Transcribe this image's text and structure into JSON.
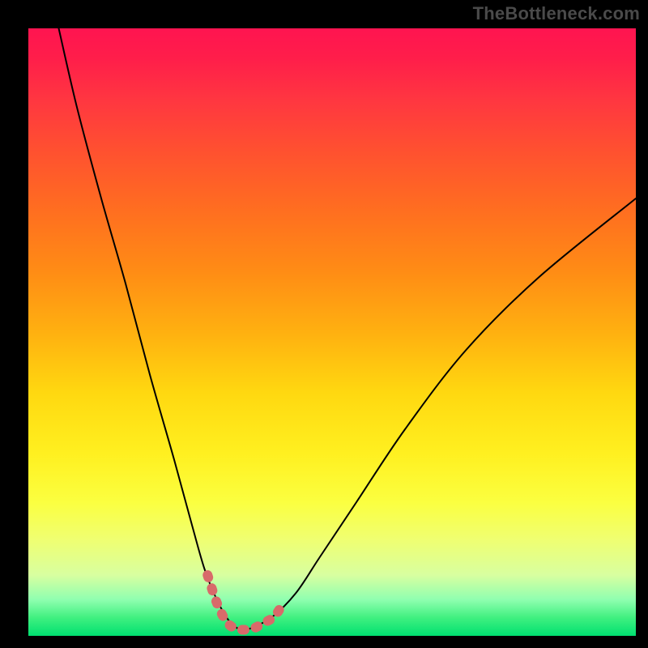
{
  "watermark": "TheBottleneck.com",
  "chart_data": {
    "type": "line",
    "title": "",
    "xlabel": "",
    "ylabel": "",
    "xlim": [
      0,
      100
    ],
    "ylim": [
      0,
      100
    ],
    "grid": false,
    "series": [
      {
        "name": "main-curve",
        "color": "#000000",
        "stroke_width": 2,
        "x": [
          5,
          8,
          12,
          16,
          20,
          24,
          27,
          29,
          31,
          33,
          34.5,
          35.5,
          36.5,
          40,
          44,
          48,
          54,
          62,
          72,
          84,
          100
        ],
        "y": [
          100,
          87,
          72,
          58,
          43,
          29,
          18,
          11,
          6,
          2.5,
          1.2,
          1,
          1.2,
          3,
          7,
          13,
          22,
          34,
          47,
          59,
          72
        ]
      },
      {
        "name": "valley-highlight",
        "color": "#d86a6a",
        "stroke_width": 12,
        "x": [
          29.5,
          31,
          32.5,
          34,
          35.5,
          37,
          38.5,
          40.5,
          42
        ],
        "y": [
          10,
          5.5,
          2.5,
          1.2,
          1,
          1.2,
          2,
          3.2,
          5.5
        ]
      }
    ],
    "background_gradient": {
      "direction": "vertical",
      "stops": [
        {
          "pos": 0,
          "color": "#ff1450"
        },
        {
          "pos": 50,
          "color": "#ffb010"
        },
        {
          "pos": 80,
          "color": "#f8ff50"
        },
        {
          "pos": 100,
          "color": "#00e070"
        }
      ]
    }
  }
}
